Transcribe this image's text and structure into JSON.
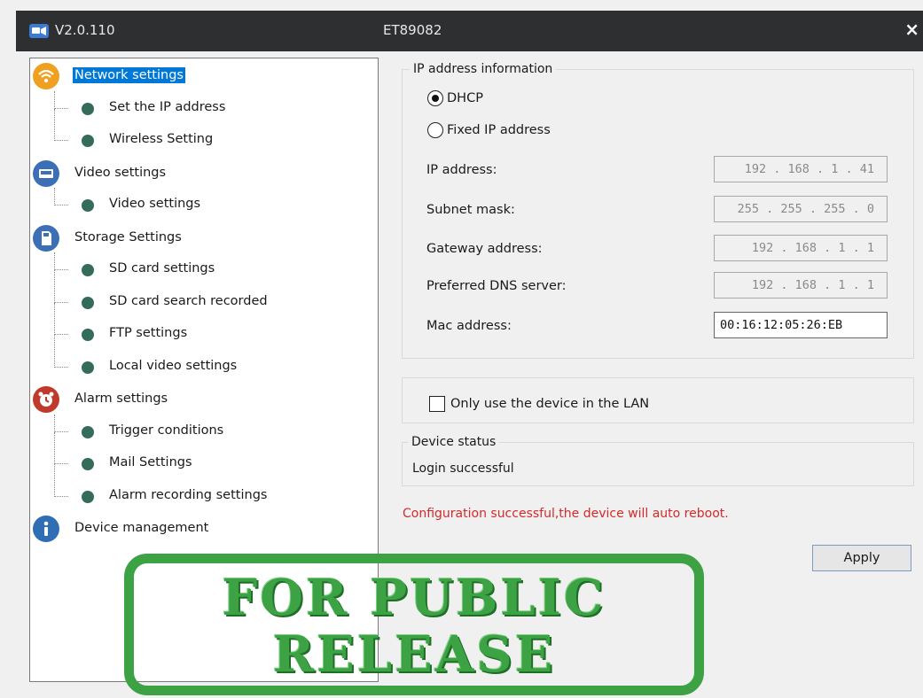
{
  "titlebar": {
    "version": "V2.0.110",
    "device_id": "ET89082",
    "close_glyph": "×"
  },
  "tree": {
    "groups": [
      {
        "label": "Network settings",
        "icon": "wifi-icon",
        "color": "#f0a020",
        "selected": true,
        "children": [
          "Set the IP address",
          "Wireless Setting"
        ]
      },
      {
        "label": "Video settings",
        "icon": "video-icon",
        "color": "#3c6fb5",
        "children": [
          "Video settings"
        ]
      },
      {
        "label": "Storage Settings",
        "icon": "storage-icon",
        "color": "#3c6fb5",
        "children": [
          "SD card settings",
          "SD card search recorded",
          "FTP settings",
          "Local video settings"
        ]
      },
      {
        "label": "Alarm settings",
        "icon": "alarm-clock-icon",
        "color": "#c0392b",
        "children": [
          "Trigger conditions",
          "Mail Settings",
          "Alarm recording settings"
        ]
      },
      {
        "label": "Device management",
        "icon": "info-icon",
        "color": "#2f6db5",
        "children": []
      }
    ]
  },
  "ip_info": {
    "title": "IP address information",
    "dhcp_label": "DHCP",
    "dhcp_selected": true,
    "fixed_label": "Fixed IP address",
    "fields": [
      {
        "label": "IP address:",
        "value": "192 . 168 .  1  . 41"
      },
      {
        "label": "Subnet mask:",
        "value": "255 . 255 . 255 .  0"
      },
      {
        "label": "Gateway address:",
        "value": "192 . 168 .  1  .  1"
      },
      {
        "label": "Preferred DNS server:",
        "value": "192 . 168 .  1  .  1"
      }
    ],
    "mac_label": "Mac address:",
    "mac_value": "00:16:12:05:26:EB"
  },
  "lan": {
    "label": "Only use the device in the LAN",
    "checked": false
  },
  "status": {
    "title": "Device status",
    "text": "Login successful"
  },
  "message": {
    "text": "Configuration successful,the device will auto reboot.",
    "color": "#d42a2a"
  },
  "apply_label": "Apply",
  "stamp": {
    "line1": "FOR PUBLIC",
    "line2": "RELEASE",
    "color": "#3ca244"
  }
}
